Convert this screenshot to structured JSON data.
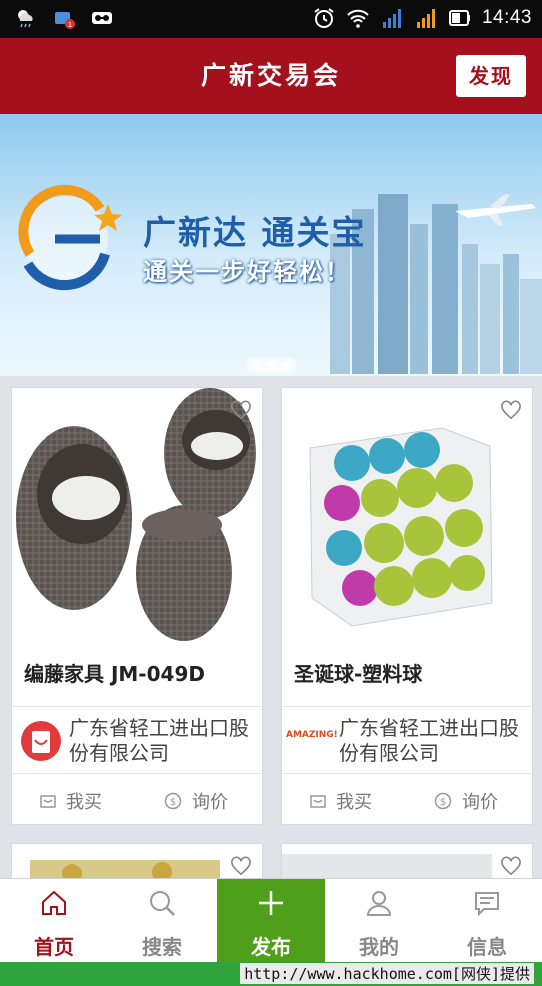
{
  "status_bar": {
    "time": "14:43"
  },
  "header": {
    "title": "广新交易会",
    "discover_label": "发现"
  },
  "banner": {
    "title": "广新达 通关宝",
    "slogan": "通关一步好轻松！"
  },
  "products": [
    {
      "title": "编藤家具  JM-049D",
      "seller": "广东省轻工进出口股份有限公司",
      "buy_label": "我买",
      "inquire_label": "询价"
    },
    {
      "title": "圣诞球-塑料球",
      "seller": "广东省轻工进出口股份有限公司",
      "seller_logo_text": "AMAZING!",
      "buy_label": "我买",
      "inquire_label": "询价"
    }
  ],
  "tabs": [
    {
      "label": "首页",
      "icon": "home-icon",
      "active": true
    },
    {
      "label": "搜索",
      "icon": "search-icon"
    },
    {
      "label": "发布",
      "icon": "plus-icon"
    },
    {
      "label": "我的",
      "icon": "user-icon"
    },
    {
      "label": "信息",
      "icon": "message-icon"
    }
  ],
  "watermark": "http://www.hackhome.com[网侠]提供",
  "colors": {
    "brand_red": "#a4101c",
    "publish_green": "#4f9f1a"
  }
}
